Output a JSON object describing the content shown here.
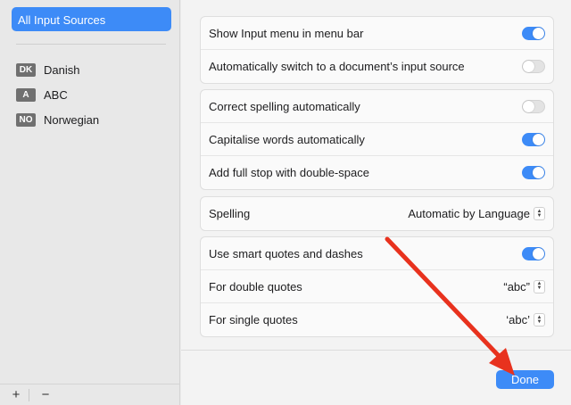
{
  "sidebar": {
    "selected": "All Input Sources",
    "sources": [
      {
        "badge": "DK",
        "label": "Danish"
      },
      {
        "badge": "A",
        "label": "ABC"
      },
      {
        "badge": "NO",
        "label": "Norwegian"
      }
    ],
    "add_label": "+",
    "remove_label": "−"
  },
  "groups": {
    "menu": [
      {
        "label": "Show Input menu in menu bar",
        "toggle": "on"
      },
      {
        "label": "Automatically switch to a document’s input source",
        "toggle": "off"
      }
    ],
    "typing": [
      {
        "label": "Correct spelling automatically",
        "toggle": "off"
      },
      {
        "label": "Capitalise words automatically",
        "toggle": "on"
      },
      {
        "label": "Add full stop with double-space",
        "toggle": "on"
      }
    ],
    "spelling": {
      "label": "Spelling",
      "value": "Automatic by Language"
    },
    "quotes": {
      "smart": {
        "label": "Use smart quotes and dashes",
        "toggle": "on"
      },
      "double": {
        "label": "For double quotes",
        "value": "“abc”"
      },
      "single": {
        "label": "For single quotes",
        "value": "‘abc’"
      }
    }
  },
  "footer": {
    "done_label": "Done"
  },
  "colors": {
    "accent": "#3d8bf7",
    "annotation_arrow": "#e8321e"
  }
}
